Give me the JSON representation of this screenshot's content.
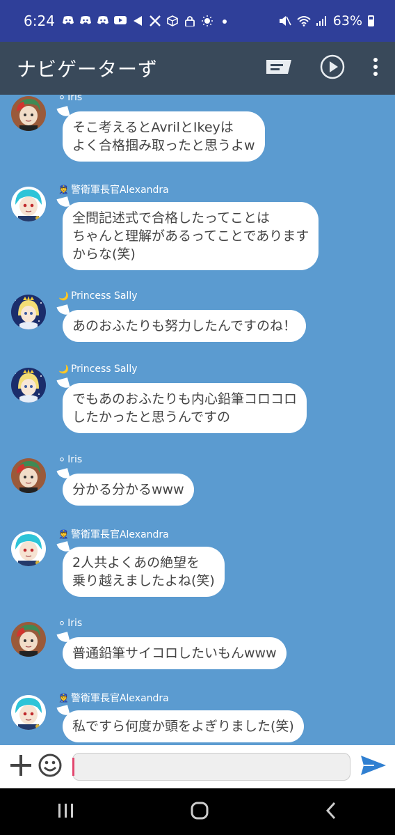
{
  "status_bar": {
    "time": "6:24",
    "battery_percent": "63%",
    "battery_level": 0.63,
    "notification_icons": [
      "discord-icon",
      "discord-icon",
      "discord-icon",
      "youtube-icon",
      "share-icon",
      "x-icon",
      "dice-icon",
      "lock-icon",
      "sun-icon",
      "dot-icon"
    ],
    "system_icons": [
      "mute-icon",
      "wifi-icon",
      "signal-icon",
      "battery-icon"
    ]
  },
  "app_bar": {
    "title": "ナビゲーターず",
    "action_icons": [
      "message-icon",
      "play-icon",
      "more-icon"
    ]
  },
  "messages": [
    {
      "sender": "Iris",
      "sender_icon": "bracelet-icon",
      "avatar": "avatar-iris",
      "text": "そこ考えるとAvrilとIkeyは\nよく合格掴み取ったと思うよw"
    },
    {
      "sender": "警衛軍長官Alexandra",
      "sender_icon": "officer-icon",
      "avatar": "avatar-alexandra",
      "text": "全問記述式で合格したってことは\nちゃんと理解があるってことであります\nからな(笑)"
    },
    {
      "sender": "Princess Sally",
      "sender_icon": "moon-icon",
      "avatar": "avatar-sally",
      "text": "あのおふたりも努力したんですのね！"
    },
    {
      "sender": "Princess Sally",
      "sender_icon": "moon-icon",
      "avatar": "avatar-sally",
      "text": "でもあのおふたりも内心鉛筆コロコロ\nしたかったと思うんですの"
    },
    {
      "sender": "Iris",
      "sender_icon": "bracelet-icon",
      "avatar": "avatar-iris",
      "text": "分かる分かるwww"
    },
    {
      "sender": "警衛軍長官Alexandra",
      "sender_icon": "officer-icon",
      "avatar": "avatar-alexandra",
      "text": "2人共よくあの絶望を\n乗り越えましたよね(笑)"
    },
    {
      "sender": "Iris",
      "sender_icon": "bracelet-icon",
      "avatar": "avatar-iris",
      "text": "普通鉛筆サイコロしたいもんwww"
    },
    {
      "sender": "警衛軍長官Alexandra",
      "sender_icon": "officer-icon",
      "avatar": "avatar-alexandra",
      "text": "私ですら何度か頭をよぎりました(笑)"
    }
  ],
  "input_bar": {
    "value": "",
    "icons": [
      "plus-icon",
      "emoji-icon",
      "send-icon"
    ]
  },
  "nav_bar": {
    "icons": [
      "recents-icon",
      "home-icon",
      "back-icon"
    ]
  },
  "colors": {
    "status_bar": "#2f3f99",
    "app_bar": "#39495a",
    "chat_background": "#5b9bd0",
    "bubble": "#ffffff",
    "send_accent": "#2f7fd1",
    "cursor": "#e2466e"
  }
}
